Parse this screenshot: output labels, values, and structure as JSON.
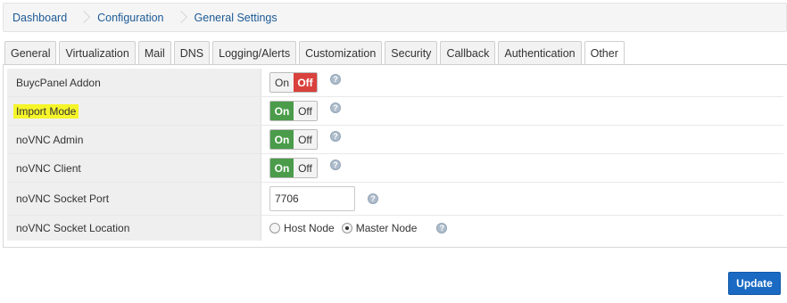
{
  "breadcrumb": [
    "Dashboard",
    "Configuration",
    "General Settings"
  ],
  "tabs": [
    {
      "label": "General",
      "active": false
    },
    {
      "label": "Virtualization",
      "active": false
    },
    {
      "label": "Mail",
      "active": false
    },
    {
      "label": "DNS",
      "active": false
    },
    {
      "label": "Logging/Alerts",
      "active": false
    },
    {
      "label": "Customization",
      "active": false
    },
    {
      "label": "Security",
      "active": false
    },
    {
      "label": "Callback",
      "active": false
    },
    {
      "label": "Authentication",
      "active": false
    },
    {
      "label": "Other",
      "active": true
    }
  ],
  "settings": {
    "buycpanel_addon": {
      "label": "BuycPanel Addon",
      "on": "On",
      "off": "Off",
      "state": "off"
    },
    "import_mode": {
      "label": "Import Mode",
      "on": "On",
      "off": "Off",
      "state": "on"
    },
    "novnc_admin": {
      "label": "noVNC Admin",
      "on": "On",
      "off": "Off",
      "state": "on"
    },
    "novnc_client": {
      "label": "noVNC Client",
      "on": "On",
      "off": "Off",
      "state": "on"
    },
    "novnc_socket_port": {
      "label": "noVNC Socket Port",
      "value": "7706"
    },
    "novnc_socket_location": {
      "label": "noVNC Socket Location",
      "options": [
        "Host Node",
        "Master Node"
      ],
      "selected": "Master Node"
    }
  },
  "help_glyph": "?",
  "update_label": "Update",
  "colors": {
    "accent": "#1a6ac4",
    "on": "#4a9c4a",
    "off": "#d9413c",
    "highlight": "#f5f52a"
  }
}
